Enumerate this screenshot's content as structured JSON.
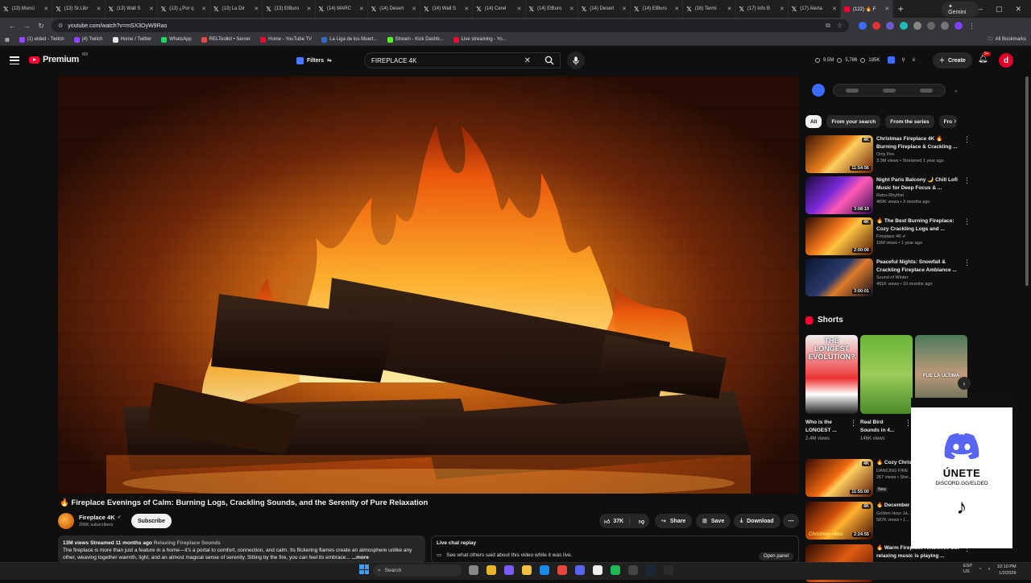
{
  "browser": {
    "tabs": [
      {
        "label": "(13) Muncl",
        "type": "x"
      },
      {
        "label": "(13) Sr.Libr",
        "type": "x"
      },
      {
        "label": "(13) Wall S",
        "type": "x"
      },
      {
        "label": "(13) ¿Por q",
        "type": "x"
      },
      {
        "label": "(13) La Dir",
        "type": "x"
      },
      {
        "label": "(13) ElBuro",
        "type": "x"
      },
      {
        "label": "(14) MARC",
        "type": "x"
      },
      {
        "label": "(14) Desert",
        "type": "x"
      },
      {
        "label": "(14) Wall S",
        "type": "x"
      },
      {
        "label": "(14) Cerel",
        "type": "x"
      },
      {
        "label": "(14) ElBuro",
        "type": "x"
      },
      {
        "label": "(14) Desert",
        "type": "x"
      },
      {
        "label": "(14) ElBuro",
        "type": "x"
      },
      {
        "label": "(16) Termi",
        "type": "x"
      },
      {
        "label": "(17) Info B",
        "type": "x"
      },
      {
        "label": "(17) Alerta",
        "type": "x"
      },
      {
        "label": "(122) 🔥 F",
        "type": "youtube",
        "active": true
      }
    ],
    "gemini_label": "Gemini",
    "url": "youtube.com/watch?v=mSX3OyW9Rao",
    "bookmarks": [
      {
        "label": "(1) elded - Twitch",
        "color": "#9146ff"
      },
      {
        "label": "(4) Twitch",
        "color": "#9146ff"
      },
      {
        "label": "Home / Twitter",
        "color": "#e8e8e8"
      },
      {
        "label": "WhatsApp",
        "color": "#25d366"
      },
      {
        "label": "RELToolkit • Server",
        "color": "#e14a4a"
      },
      {
        "label": "Home - YouTube TV",
        "color": "#ff0033"
      },
      {
        "label": "La Liga de los Muert...",
        "color": "#2a6bd4"
      },
      {
        "label": "Stream - Kick Dashb...",
        "color": "#53fc18"
      },
      {
        "label": "Live streaming - Yo...",
        "color": "#ff0033"
      }
    ],
    "all_bookmarks": "All Bookmarks"
  },
  "youtube": {
    "brand": "Premium",
    "region": "MX",
    "filters_label": "Filters",
    "search_value": "FIREPLACE 4K",
    "stats": [
      "9.5M",
      "5,786",
      "185K"
    ],
    "create_label": "Create",
    "notif_count": "9+",
    "avatar_letter": "d"
  },
  "video": {
    "title": "🔥 Fireplace Evenings of Calm: Burning Logs, Crackling Sounds, and the Serenity of Pure Relaxation",
    "channel": "Fireplace 4K",
    "subscribers": "206K subscribers",
    "subscribe_label": "Subscribe",
    "likes": "37K",
    "share_label": "Share",
    "save_label": "Save",
    "download_label": "Download",
    "views_meta": "13M views  Streamed 11 months ago",
    "tag": "Relaxing Fireplace Sounds",
    "description": "The fireplace is more than just a feature in a home—it's a portal to comfort, connection, and calm. Its flickering flames create an atmosphere unlike any other, weaving together warmth, light, and an almost magical sense of serenity. Sitting by the fire, you can feel its embrace...",
    "desc_more": "...more",
    "live_chat_title": "Live chat replay",
    "live_chat_sub": "See what others said about this video while it was live.",
    "open_panel": "Open panel"
  },
  "sidebar": {
    "chips": [
      "All",
      "From your search",
      "From the series",
      "Fro"
    ],
    "recommended": [
      {
        "title": "Christmas Fireplace 4K 🔥 Burning Fireplace & Crackling ...",
        "channel": "Only Fire",
        "meta": "3.3M views • Streamed 1 year ago",
        "duration": "11:54:56",
        "badge": "4K"
      },
      {
        "title": "Night Paris Balcony 🌙 Chill Lofi Music for Deep Focus & ...",
        "channel": "Retro-Rhythm",
        "meta": "489K views • 3 months ago",
        "duration": "3:08:19",
        "badge": ""
      },
      {
        "title": "🔥 The Best Burning Fireplace: Cozy Crackling Logs and ...",
        "channel": "Fireplace 4K ✔",
        "meta": "16M views • 1 year ago",
        "duration": "2:00:06",
        "badge": "4K"
      },
      {
        "title": "Peaceful Nights: Snowfall & Crackling Fireplace Ambiance ...",
        "channel": "Sound of Winter",
        "meta": "491K views • 10 months ago",
        "duration": "3:00:01",
        "badge": ""
      }
    ],
    "shorts_label": "Shorts",
    "shorts": [
      {
        "title": "Who is the LONGEST ...",
        "views": "2.4M views",
        "overlay": "THE LONGEST EVOLUTION?"
      },
      {
        "title": "Real Bird Sounds in 4...",
        "views": "146K views",
        "overlay": ""
      },
      {
        "title": "FUE LA ÚLTIMA",
        "views": "",
        "overlay": "FUE LA ÚLTIMA"
      }
    ],
    "recommended2": [
      {
        "title": "🔥 Cozy Chris... 4K (12 Hours)",
        "channel": "DANCING FIRE",
        "meta": "267 views • Stre...",
        "duration": "11:55:00",
        "badge": "4K",
        "new": "New"
      },
      {
        "title": "🔥 December ... Cozy Christm...",
        "channel": "Golden Hour Ja...",
        "meta": "587K views • 1...",
        "duration": "2:24:55",
        "badge": "4K",
        "thumb_text": "Christmas vibes"
      },
      {
        "title": "🔥 Warm Fireplace Ambience but relaxing music is playing ...",
        "channel": "",
        "meta": "",
        "duration": "",
        "badge": ""
      }
    ]
  },
  "overlay": {
    "une": "ÚNETE",
    "link": "DISCORD.GG/ELDED"
  },
  "taskbar": {
    "search_placeholder": "Search",
    "lang": "ESP\nUS",
    "time": "10:10 PM",
    "date": "1/2/2026"
  }
}
